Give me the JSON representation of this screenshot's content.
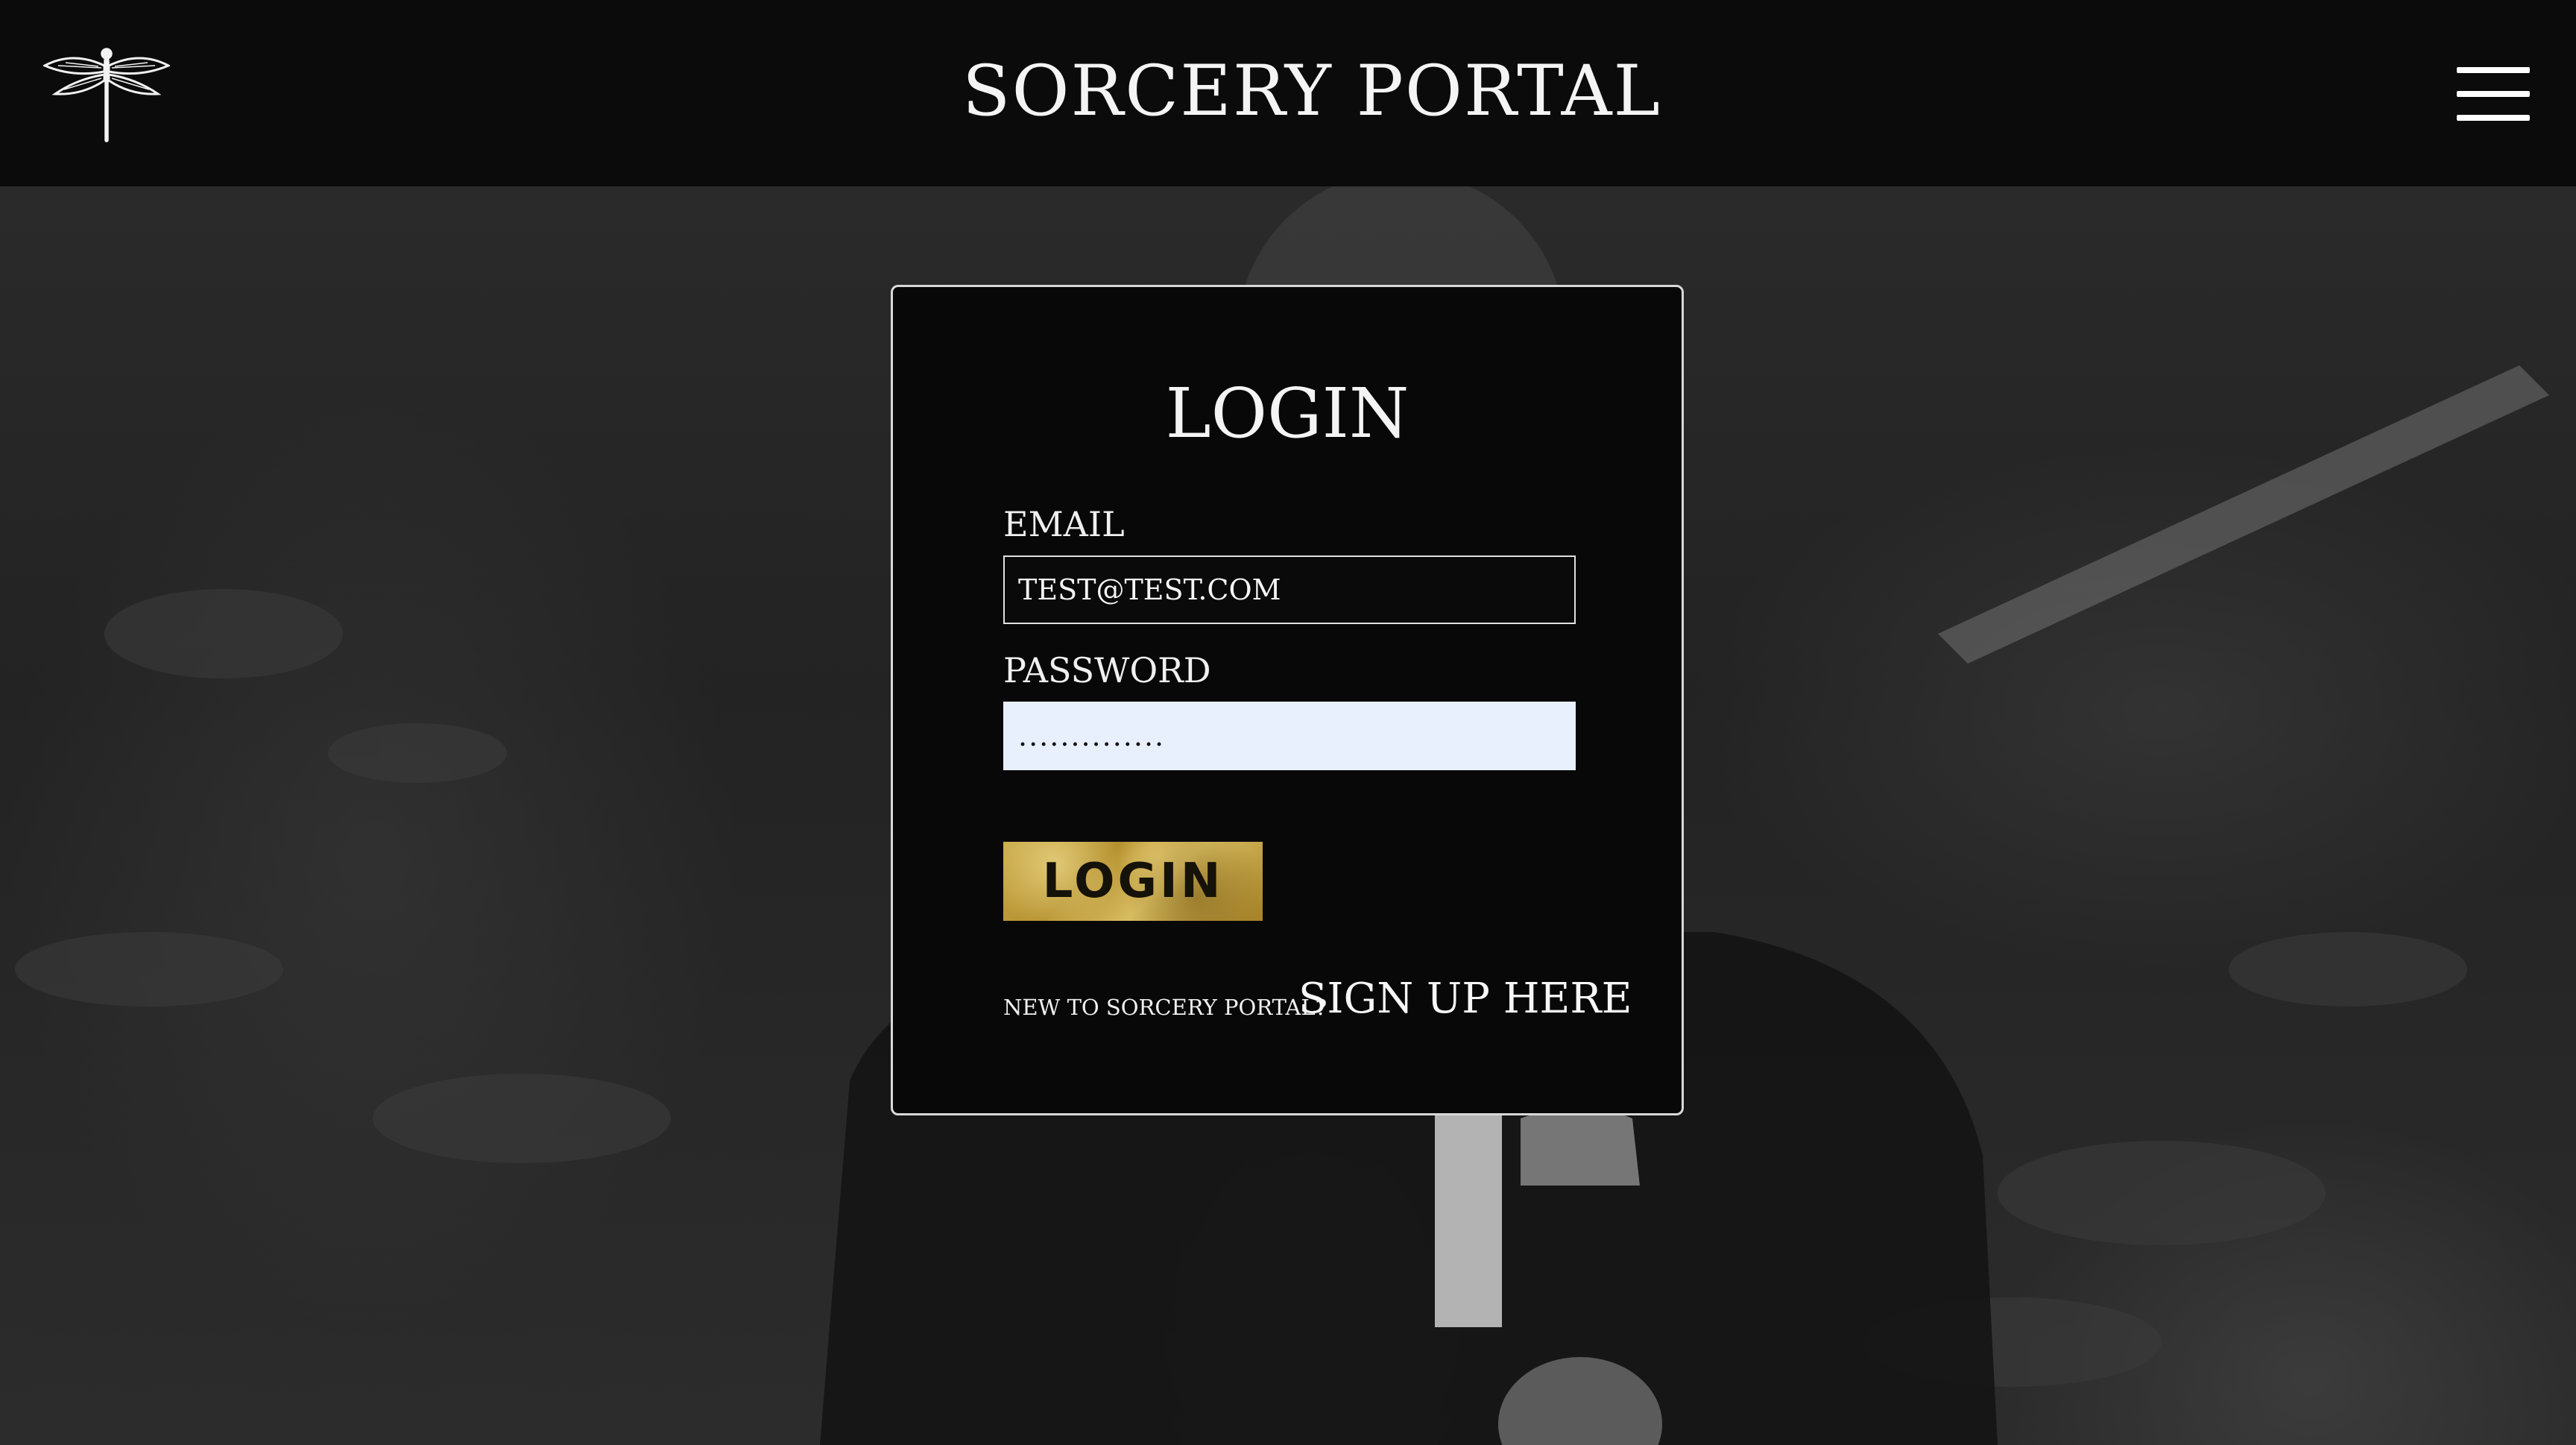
{
  "header": {
    "logo_icon": "dragonfly-icon",
    "title": "SORCERY PORTAL",
    "menu_icon": "hamburger-menu-icon"
  },
  "login": {
    "title": "LOGIN",
    "email_label": "EMAIL",
    "email_value": "TEST@TEST.COM",
    "password_label": "PASSWORD",
    "password_value": "..............",
    "button_label": "LOGIN",
    "signup_prompt": "NEW TO SORCERY PORTAL?",
    "signup_link": "SIGN UP HERE"
  },
  "colors": {
    "background": "#0a0a0a",
    "text": "#f4f4f4",
    "gold_button": "#c9a848",
    "password_autofill_bg": "#e8f0fe"
  }
}
